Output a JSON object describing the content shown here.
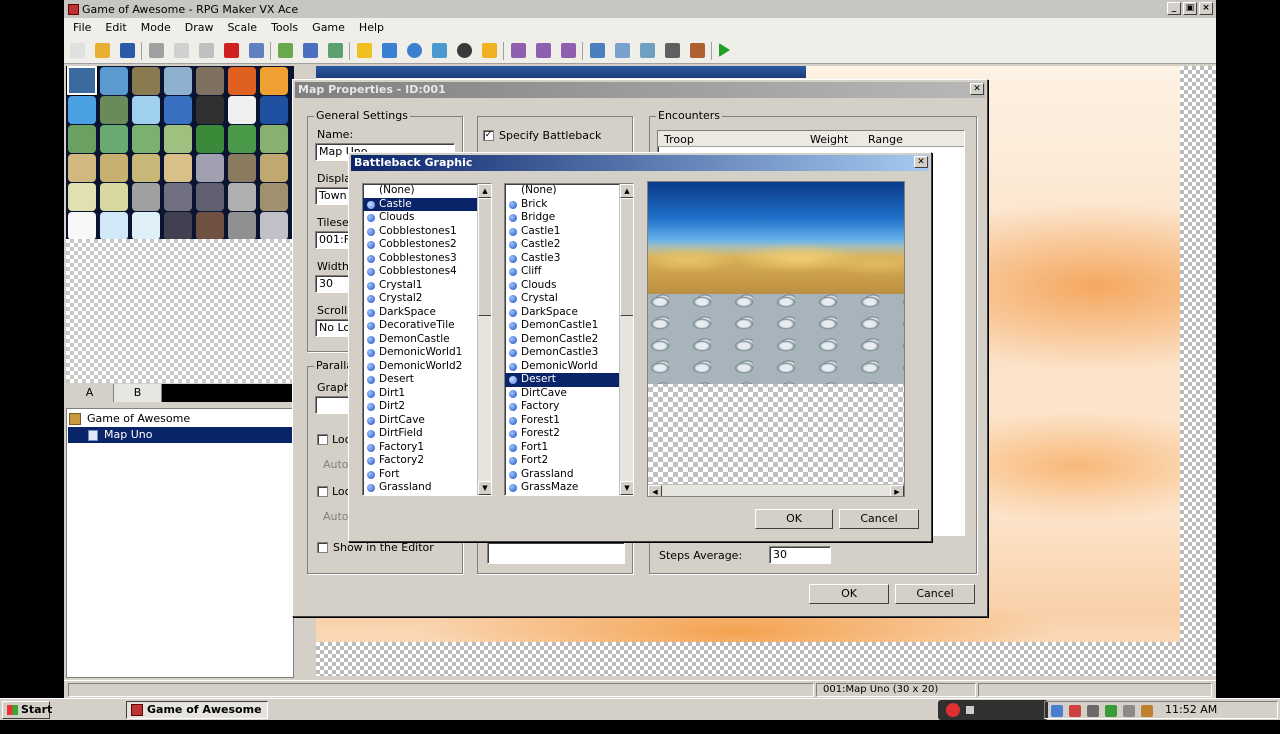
{
  "window": {
    "title": "Game of Awesome - RPG Maker VX Ace",
    "buttons": [
      "_",
      "▣",
      "×"
    ]
  },
  "menu": [
    "File",
    "Edit",
    "Mode",
    "Draw",
    "Scale",
    "Tools",
    "Game",
    "Help"
  ],
  "toolbar_icons": [
    "new-project-icon",
    "open-project-icon",
    "save-project-icon",
    "cut-icon",
    "copy-icon",
    "paste-icon",
    "delete-icon",
    "undo-icon",
    "map-mode-icon",
    "event-mode-icon",
    "region-mode-icon",
    "pencil-icon",
    "rectangle-icon",
    "ellipse-icon",
    "flood-fill-icon",
    "shadow-pen-icon",
    "scale-1-1-icon",
    "scale-1-2-icon",
    "scale-1-4-icon",
    "scale-1-8-icon",
    "database-icon",
    "resource-manager-icon",
    "script-editor-icon",
    "sound-test-icon",
    "character-generator-icon",
    "playtest-icon"
  ],
  "tileset_tabs": [
    "A",
    "B"
  ],
  "tree": {
    "project": "Game of Awesome",
    "map": "Map Uno"
  },
  "status": {
    "map_info": "001:Map Uno (30 x 20)"
  },
  "map_props": {
    "title": "Map Properties - ID:001",
    "general_label": "General Settings",
    "name_label": "Name:",
    "name_value": "Map Uno",
    "display_label": "Displa",
    "display_value": "Town",
    "tileset_label": "Tileset",
    "tileset_value": "001:F",
    "width_label": "Width:",
    "width_value": "30",
    "scroll_label": "Scroll",
    "scroll_value": "No Lo",
    "specify_battleback": "Specify Battleback",
    "parallax_label": "Paralla",
    "graphic_label": "Graph",
    "loop1": "Loo",
    "auto1": "Auto",
    "loop2": "Loo",
    "auto2": "Auto",
    "show_in_editor": "Show in the Editor",
    "encounters_label": "Encounters",
    "col_troop": "Troop",
    "col_weight": "Weight",
    "col_range": "Range",
    "steps_label": "Steps Average:",
    "steps_value": "30",
    "ok": "OK",
    "cancel": "Cancel"
  },
  "battleback": {
    "title": "Battleback Graphic",
    "list1": [
      "(None)",
      "Castle",
      "Clouds",
      "Cobblestones1",
      "Cobblestones2",
      "Cobblestones3",
      "Cobblestones4",
      "Crystal1",
      "Crystal2",
      "DarkSpace",
      "DecorativeTile",
      "DemonCastle",
      "DemonicWorld1",
      "DemonicWorld2",
      "Desert",
      "Dirt1",
      "Dirt2",
      "DirtCave",
      "DirtField",
      "Factory1",
      "Factory2",
      "Fort",
      "Grassland"
    ],
    "list1_selected": "Castle",
    "list2": [
      "(None)",
      "Brick",
      "Bridge",
      "Castle1",
      "Castle2",
      "Castle3",
      "Cliff",
      "Clouds",
      "Crystal",
      "DarkSpace",
      "DemonCastle1",
      "DemonCastle2",
      "DemonCastle3",
      "DemonicWorld",
      "Desert",
      "DirtCave",
      "Factory",
      "Forest1",
      "Forest2",
      "Fort1",
      "Fort2",
      "Grassland",
      "GrassMaze"
    ],
    "list2_selected": "Desert",
    "ok": "OK",
    "cancel": "Cancel"
  },
  "taskbar": {
    "start": "Start",
    "task": "Game of Awesome - ...",
    "clock": "11:52 AM"
  }
}
